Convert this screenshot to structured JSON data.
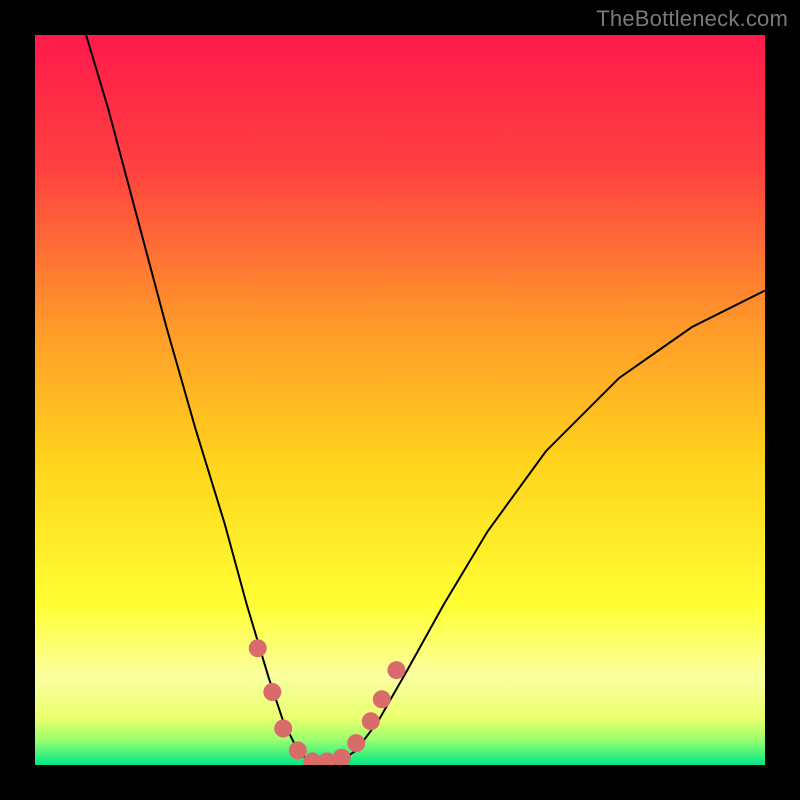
{
  "watermark": "TheBottleneck.com",
  "chart_data": {
    "type": "line",
    "title": "",
    "xlabel": "",
    "ylabel": "",
    "xlim": [
      0,
      100
    ],
    "ylim": [
      0,
      100
    ],
    "background_gradient_stops": [
      {
        "offset": 0.0,
        "color": "#ff1a4b"
      },
      {
        "offset": 0.18,
        "color": "#ff4040"
      },
      {
        "offset": 0.4,
        "color": "#ff9a2a"
      },
      {
        "offset": 0.58,
        "color": "#ffd21c"
      },
      {
        "offset": 0.78,
        "color": "#ffff33"
      },
      {
        "offset": 0.88,
        "color": "#faffa0"
      },
      {
        "offset": 0.935,
        "color": "#eaff6e"
      },
      {
        "offset": 0.965,
        "color": "#9cff6e"
      },
      {
        "offset": 1.0,
        "color": "#00e887"
      }
    ],
    "curve_points": [
      {
        "x": 7,
        "y": 100
      },
      {
        "x": 10,
        "y": 90
      },
      {
        "x": 14,
        "y": 75
      },
      {
        "x": 18,
        "y": 60
      },
      {
        "x": 22,
        "y": 46
      },
      {
        "x": 26,
        "y": 33
      },
      {
        "x": 29,
        "y": 22
      },
      {
        "x": 32,
        "y": 12
      },
      {
        "x": 34,
        "y": 6
      },
      {
        "x": 36,
        "y": 2
      },
      {
        "x": 38,
        "y": 0
      },
      {
        "x": 41,
        "y": 0
      },
      {
        "x": 44,
        "y": 2
      },
      {
        "x": 47,
        "y": 6
      },
      {
        "x": 51,
        "y": 13
      },
      {
        "x": 56,
        "y": 22
      },
      {
        "x": 62,
        "y": 32
      },
      {
        "x": 70,
        "y": 43
      },
      {
        "x": 80,
        "y": 53
      },
      {
        "x": 90,
        "y": 60
      },
      {
        "x": 100,
        "y": 65
      }
    ],
    "marker_points": [
      {
        "x": 30.5,
        "y": 16
      },
      {
        "x": 32.5,
        "y": 10
      },
      {
        "x": 34.0,
        "y": 5
      },
      {
        "x": 36.0,
        "y": 2
      },
      {
        "x": 38.0,
        "y": 0.5
      },
      {
        "x": 40.0,
        "y": 0.5
      },
      {
        "x": 42.0,
        "y": 1
      },
      {
        "x": 44.0,
        "y": 3
      },
      {
        "x": 46.0,
        "y": 6
      },
      {
        "x": 47.5,
        "y": 9
      },
      {
        "x": 49.5,
        "y": 13
      }
    ],
    "marker_color": "#d96b6b",
    "curve_color": "#000000"
  }
}
